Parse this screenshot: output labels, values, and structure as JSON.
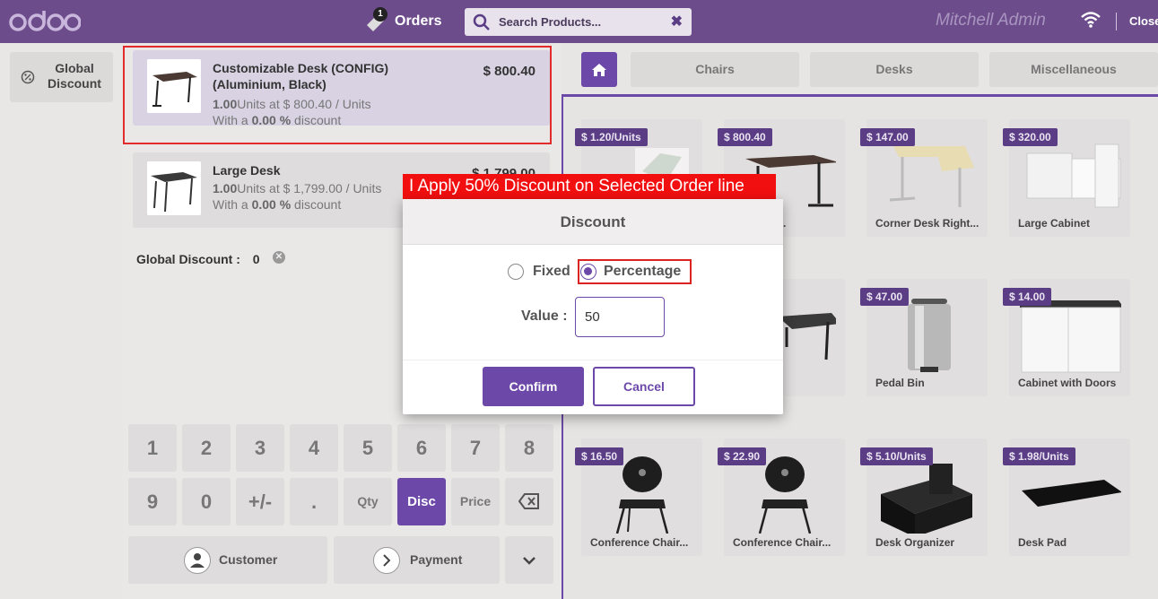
{
  "header": {
    "orders_label": "Orders",
    "orders_count": "1",
    "search_placeholder": "Search Products...",
    "user": "Mitchell Admin",
    "close_label": "Close"
  },
  "left": {
    "global_discount_btn": "Global Discount",
    "global_discount_label": "Global Discount :",
    "global_discount_value": "0"
  },
  "order_lines": [
    {
      "name": "Customizable Desk (CONFIG) (Aluminium, Black)",
      "price": "$ 800.40",
      "qty": "1.00",
      "unit_text": "Units at $ 800.40 / Units",
      "disc_prefix": "With a ",
      "disc_value": "0.00 %",
      "disc_suffix": " discount"
    },
    {
      "name": "Large Desk",
      "price": "$ 1,799.00",
      "qty": "1.00",
      "unit_text": "Units at $ 1,799.00 / Units",
      "disc_prefix": "With a ",
      "disc_value": "0.00 %",
      "disc_suffix": " discount"
    }
  ],
  "numpad": {
    "row1": [
      "1",
      "2",
      "3",
      "4",
      "5",
      "6",
      "7",
      "8"
    ],
    "row2": [
      "9",
      "0",
      "+/-",
      ".",
      "Qty",
      "Disc",
      "Price"
    ],
    "customer": "Customer",
    "payment": "Payment"
  },
  "categories": [
    "Chairs",
    "Desks",
    "Miscellaneous"
  ],
  "products": [
    {
      "name": "",
      "price": "$ 1.20/Units"
    },
    {
      "name": "able Des...",
      "price": "$ 800.40"
    },
    {
      "name": "Corner Desk Right...",
      "price": "$ 147.00"
    },
    {
      "name": "Large Cabinet",
      "price": "$ 320.00"
    },
    {
      "name": "",
      "price": ""
    },
    {
      "name": "k",
      "price": ""
    },
    {
      "name": "Pedal Bin",
      "price": "$ 47.00"
    },
    {
      "name": "Cabinet with Doors",
      "price": "$ 14.00"
    },
    {
      "name": "Conference Chair...",
      "price": "$ 16.50"
    },
    {
      "name": "Conference Chair...",
      "price": "$ 22.90"
    },
    {
      "name": "Desk Organizer",
      "price": "$ 5.10/Units"
    },
    {
      "name": "Desk Pad",
      "price": "$ 1.98/Units"
    }
  ],
  "annotation": "I Apply 50% Discount on Selected Order line",
  "modal": {
    "title": "Discount",
    "fixed_label": "Fixed",
    "percentage_label": "Percentage",
    "selected": "Percentage",
    "value_label": "Value :",
    "value": "50",
    "confirm": "Confirm",
    "cancel": "Cancel"
  },
  "colors": {
    "primary": "#6c49a8",
    "header": "#6d4c8b",
    "highlight": "#e22b2b"
  }
}
